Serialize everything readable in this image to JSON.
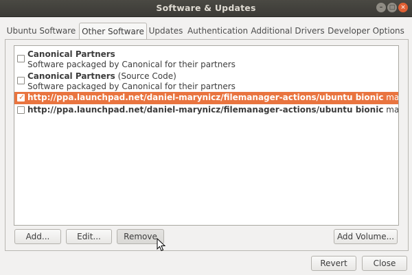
{
  "window": {
    "title": "Software & Updates"
  },
  "tabs": [
    {
      "label": "Ubuntu Software",
      "active": false
    },
    {
      "label": "Other Software",
      "active": true
    },
    {
      "label": "Updates",
      "active": false
    },
    {
      "label": "Authentication",
      "active": false
    },
    {
      "label": "Additional Drivers",
      "active": false
    },
    {
      "label": "Developer Options",
      "active": false
    }
  ],
  "sources": [
    {
      "name": "Canonical Partners",
      "suffix": "",
      "description": "Software packaged by Canonical for their partners",
      "checked": false,
      "selected": false
    },
    {
      "name": "Canonical Partners",
      "suffix": " (Source Code)",
      "description": "Software packaged by Canonical for their partners",
      "checked": false,
      "selected": false
    },
    {
      "name": "http://ppa.launchpad.net/daniel-marynicz/filemanager-actions/ubuntu bionic",
      "suffix": " main",
      "description": "",
      "checked": true,
      "selected": true
    },
    {
      "name": "http://ppa.launchpad.net/daniel-marynicz/filemanager-actions/ubuntu bionic",
      "suffix": " main (Source Code)",
      "description": "",
      "checked": false,
      "selected": false
    }
  ],
  "buttons": {
    "add": "Add...",
    "edit": "Edit...",
    "remove": "Remove",
    "add_volume": "Add Volume...",
    "revert": "Revert",
    "close": "Close"
  },
  "colors": {
    "selection": "#e9743f",
    "titlebar": "#3c3b37",
    "close_button": "#df5f33"
  },
  "icons": {
    "minimize": "minimize-icon",
    "maximize": "maximize-icon",
    "close": "close-icon",
    "cursor": "mouse-pointer-icon"
  }
}
